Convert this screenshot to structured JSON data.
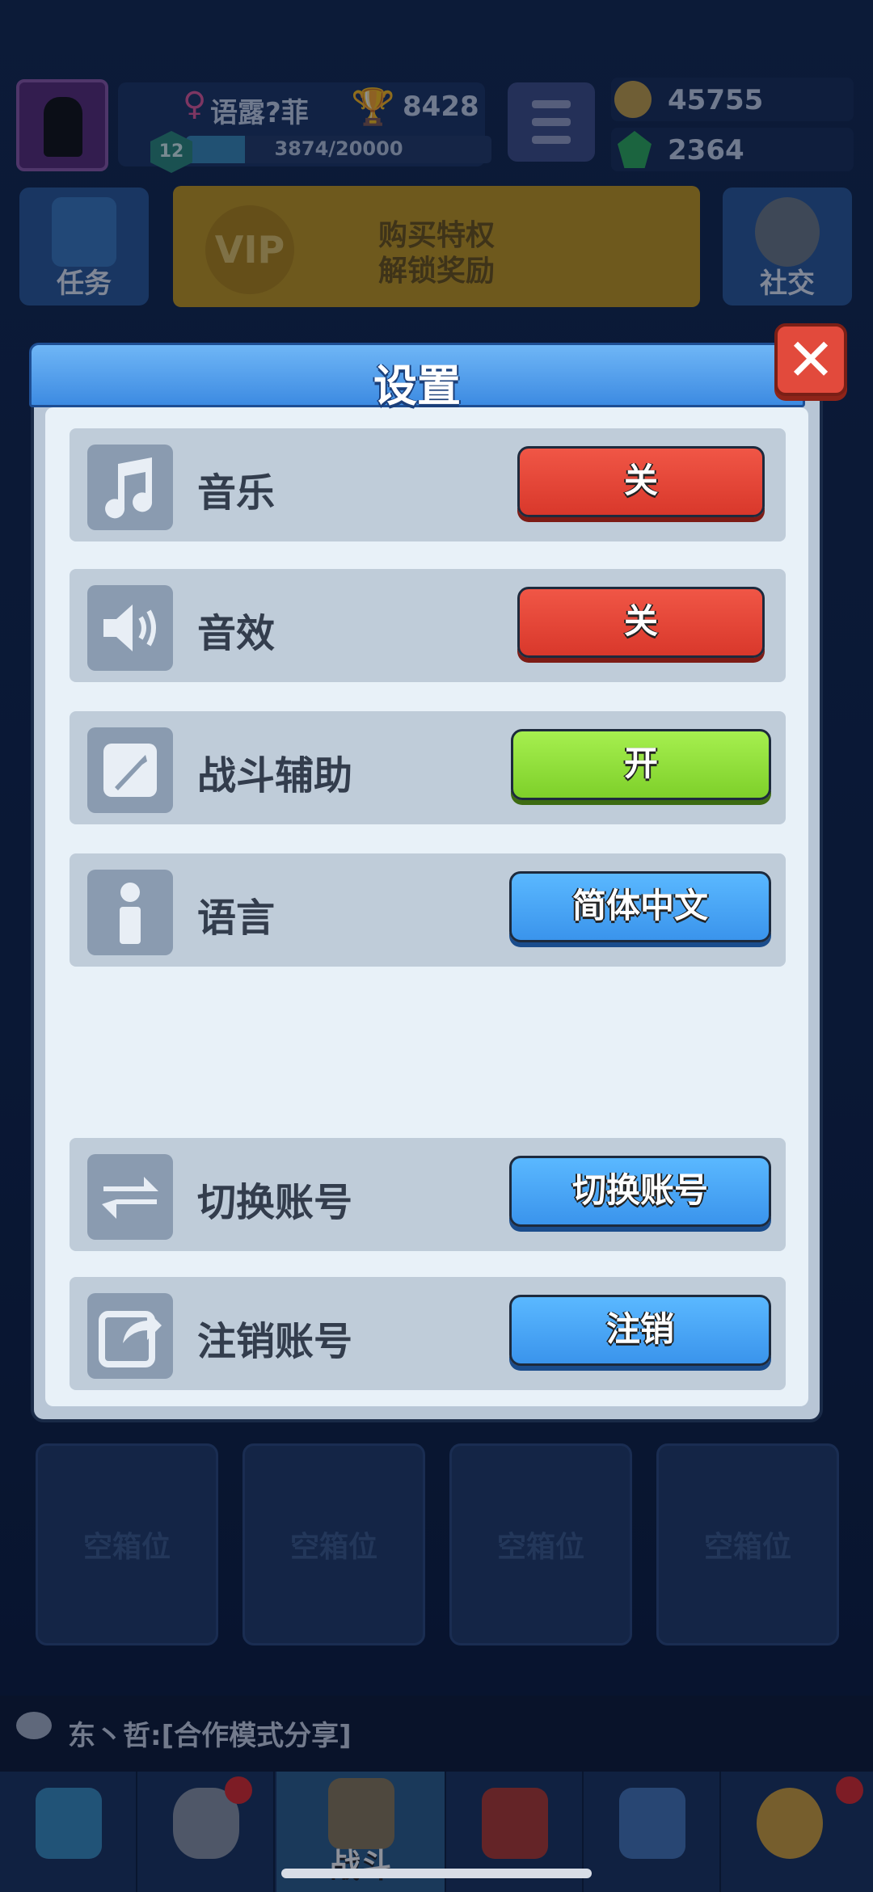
{
  "player": {
    "name": "语露?菲",
    "gender_icon": "female-symbol-icon",
    "trophies": "8428",
    "level": "12",
    "xp_text": "3874/20000",
    "xp_progress": 0.1937
  },
  "currencies": {
    "gold": "45755",
    "gems": "2364"
  },
  "side_buttons": {
    "tasks": "任务",
    "social": "社交"
  },
  "vip_banner": {
    "logo": "VIP",
    "line1": "购买特权",
    "line2": "解锁奖励"
  },
  "chests": [
    "空箱位",
    "空箱位",
    "空箱位",
    "空箱位"
  ],
  "chat": {
    "message": "东丶哲:[合作模式分享]"
  },
  "nav": {
    "battle_label": "战斗"
  },
  "dialog": {
    "title": "设置",
    "rows": [
      {
        "label": "音乐",
        "button": "关",
        "icon": "music-note-icon",
        "state_color": "#e0473a"
      },
      {
        "label": "音效",
        "button": "关",
        "icon": "speaker-icon",
        "state_color": "#e0473a"
      },
      {
        "label": "战斗辅助",
        "button": "开",
        "icon": "sword-icon",
        "state_color": "#8fdd3a"
      },
      {
        "label": "语言",
        "button": "简体中文",
        "icon": "info-icon",
        "state_color": "#46a4f5"
      },
      {
        "label": "切换账号",
        "button": "切换账号",
        "icon": "swap-arrows-icon",
        "state_color": "#46a4f5"
      },
      {
        "label": "注销账号",
        "button": "注销",
        "icon": "share-out-icon",
        "state_color": "#46a4f5"
      }
    ]
  }
}
